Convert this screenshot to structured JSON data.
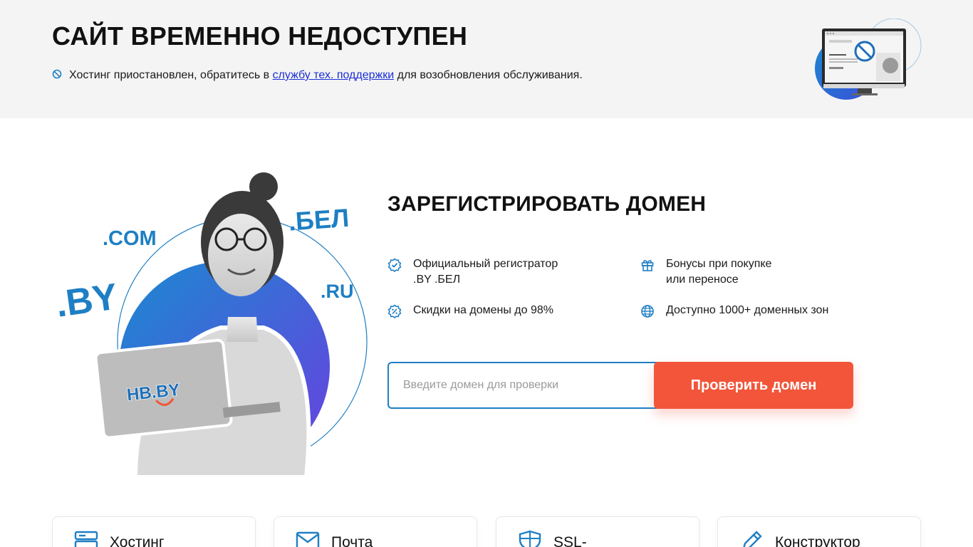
{
  "banner": {
    "title": "САЙТ ВРЕМЕННО НЕДОСТУПЕН",
    "notice_before": "Хостинг приостановлен, обратитесь в ",
    "notice_link": "службу тех. поддержки",
    "notice_after": " для возобновления обслуживания.",
    "icon": "ban-icon"
  },
  "hero": {
    "domain_tags": [
      ".COM",
      ".БЕЛ",
      ".BY",
      ".RU"
    ],
    "laptop_logo": "HB.BY"
  },
  "domain": {
    "title": "ЗАРЕГИСТРИРОВАТЬ ДОМЕН",
    "features": [
      {
        "icon": "badge-check-icon",
        "text": "Официальный регистратор\n.BY .БЕЛ"
      },
      {
        "icon": "gift-icon",
        "text": "Бонусы при покупке\nили переносе"
      },
      {
        "icon": "discount-icon",
        "text": "Скидки на домены до 98%"
      },
      {
        "icon": "globe-icon",
        "text": "Доступно 1000+ доменных зон"
      }
    ],
    "search": {
      "placeholder": "Введите домен для проверки",
      "value": "",
      "button_label": "Проверить домен"
    }
  },
  "services": [
    {
      "icon": "server-icon",
      "label": "Хостинг"
    },
    {
      "icon": "mail-icon",
      "label": "Почта"
    },
    {
      "icon": "shield-icon",
      "label": "SSL-"
    },
    {
      "icon": "pencil-icon",
      "label": "Конструктор"
    }
  ],
  "colors": {
    "accent_blue": "#1e7fc4",
    "button_red": "#f2553a",
    "banner_bg": "#f4f4f4",
    "link": "#1a2fd6",
    "gradient_start": "#1a8ad0",
    "gradient_end": "#6a3fe0"
  }
}
